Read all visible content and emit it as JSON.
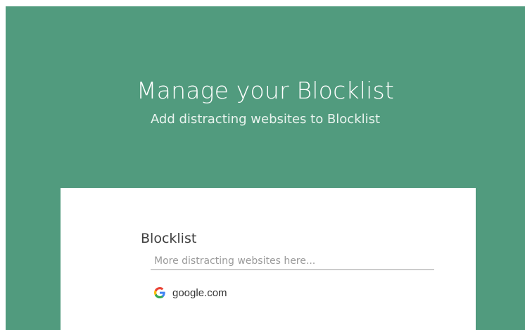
{
  "hero": {
    "title": "Manage your Blocklist",
    "subtitle": "Add distracting websites to Blocklist"
  },
  "card": {
    "title": "Blocklist",
    "input": {
      "placeholder": "More distracting websites here...",
      "value": ""
    },
    "sites": [
      {
        "label": "google.com",
        "icon": "google-icon"
      }
    ]
  },
  "colors": {
    "background": "#519b7e",
    "card": "#ffffff",
    "underline": "#9e9e9e"
  }
}
